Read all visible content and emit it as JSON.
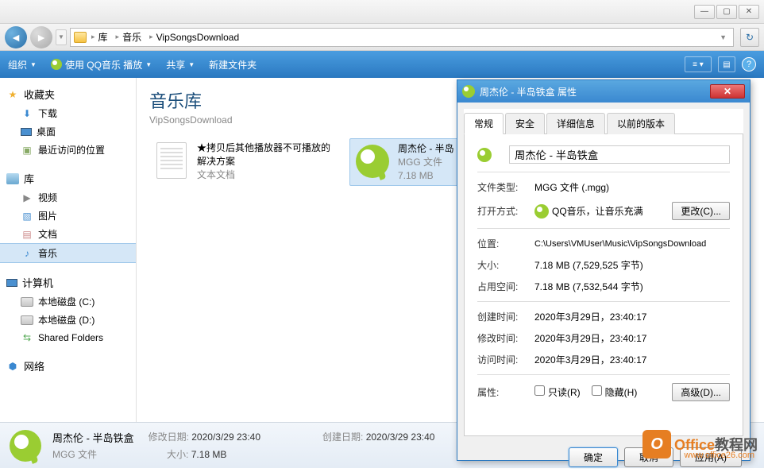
{
  "window": {
    "min": "—",
    "max": "▢",
    "close": "✕"
  },
  "breadcrumb": {
    "seg1": "库",
    "seg2": "音乐",
    "seg3": "VipSongsDownload"
  },
  "toolbar": {
    "organize": "组织",
    "play": "使用 QQ音乐 播放",
    "share": "共享",
    "newfolder": "新建文件夹"
  },
  "sidebar": {
    "favorites": "收藏夹",
    "downloads": "下载",
    "desktop": "桌面",
    "recent": "最近访问的位置",
    "libraries": "库",
    "videos": "视频",
    "pictures": "图片",
    "documents": "文档",
    "music": "音乐",
    "computer": "计算机",
    "driveC": "本地磁盘 (C:)",
    "driveD": "本地磁盘 (D:)",
    "shared": "Shared Folders",
    "network": "网络"
  },
  "content": {
    "libname": "音乐库",
    "libsub": "VipSongsDownload",
    "file1": {
      "name": "★拷贝后其他播放器不可播放的解决方案",
      "type": "文本文档"
    },
    "file2": {
      "name": "周杰伦 - 半岛",
      "type": "MGG 文件",
      "size": "7.18 MB"
    }
  },
  "status": {
    "name": "周杰伦 - 半岛铁盒",
    "type": "MGG 文件",
    "modlabel": "修改日期:",
    "modval": "2020/3/29 23:40",
    "sizelabel": "大小:",
    "sizeval": "7.18 MB",
    "createlabel": "创建日期:",
    "createval": "2020/3/29 23:40"
  },
  "dialog": {
    "title": "周杰伦 - 半岛铁盒 属性",
    "tabs": {
      "general": "常规",
      "security": "安全",
      "details": "详细信息",
      "previous": "以前的版本"
    },
    "filename": "周杰伦 - 半岛铁盒",
    "labels": {
      "filetype": "文件类型:",
      "openwith": "打开方式:",
      "location": "位置:",
      "size": "大小:",
      "sizedisk": "占用空间:",
      "created": "创建时间:",
      "modified": "修改时间:",
      "accessed": "访问时间:",
      "attributes": "属性:"
    },
    "values": {
      "filetype": "MGG 文件 (.mgg)",
      "openwith": "QQ音乐，让音乐充满",
      "location": "C:\\Users\\VMUser\\Music\\VipSongsDownload",
      "size": "7.18 MB (7,529,525 字节)",
      "sizedisk": "7.18 MB (7,532,544 字节)",
      "created": "2020年3月29日，23:40:17",
      "modified": "2020年3月29日，23:40:17",
      "accessed": "2020年3月29日，23:40:17"
    },
    "buttons": {
      "change": "更改(C)...",
      "readonly": "只读(R)",
      "hidden": "隐藏(H)",
      "advanced": "高级(D)...",
      "ok": "确定",
      "cancel": "取消",
      "apply": "应用(A)"
    }
  },
  "watermark": {
    "brand": "Office",
    "brand2": "教程网",
    "url": "www.office26.com"
  }
}
